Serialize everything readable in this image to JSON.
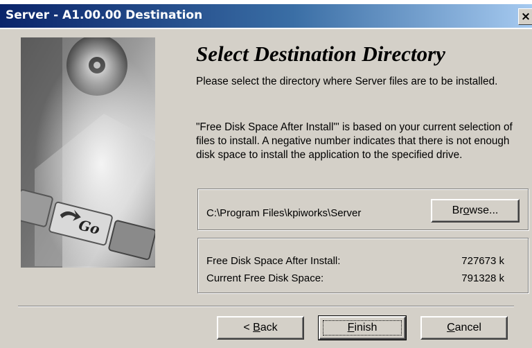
{
  "window": {
    "title": "Server - A1.00.00 Destination",
    "close_label": "×"
  },
  "content": {
    "heading": "Select Destination Directory",
    "intro": "Please select the directory where Server files are to be installed.",
    "explanation": "\"Free Disk Space After Install\"' is based on your current selection of files to install.  A negative number indicates that there is not enough disk space to install the application to the specified drive."
  },
  "destination": {
    "path": "C:\\Program Files\\kpiworks\\Server",
    "browse_pre": "Br",
    "browse_u": "o",
    "browse_post": "wse..."
  },
  "disk_space": {
    "after_install_label": "Free Disk Space After Install:",
    "after_install_value": "727673 k",
    "current_label": "Current Free Disk Space:",
    "current_value": "791328 k"
  },
  "buttons": {
    "back_pre": "< ",
    "back_u": "B",
    "back_post": "ack",
    "finish_u": "F",
    "finish_post": "inish",
    "cancel_u": "C",
    "cancel_post": "ancel"
  },
  "image": {
    "button_text": "Go"
  }
}
